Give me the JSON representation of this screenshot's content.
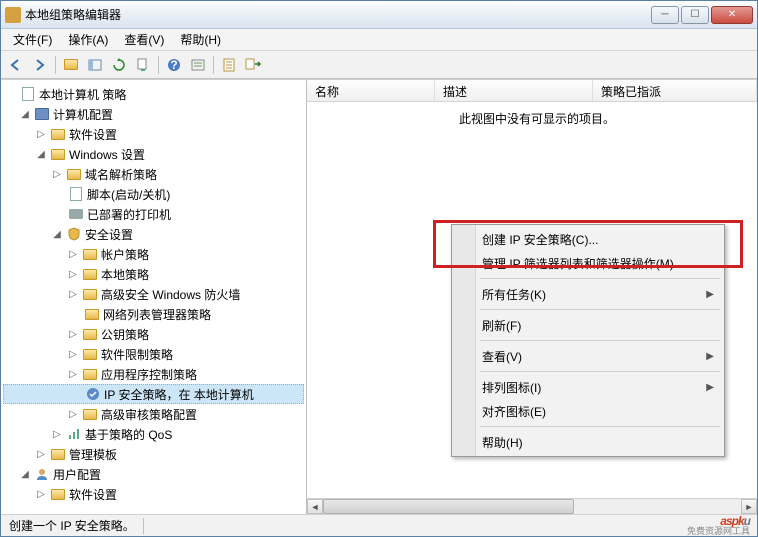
{
  "window": {
    "title": "本地组策略编辑器"
  },
  "menu": {
    "file": "文件(F)",
    "action": "操作(A)",
    "view": "查看(V)",
    "help": "帮助(H)"
  },
  "tree": {
    "root": "本地计算机 策略",
    "computer_config": "计算机配置",
    "software_settings": "软件设置",
    "windows_settings": "Windows 设置",
    "dns_policy": "域名解析策略",
    "scripts": "脚本(启动/关机)",
    "deployed_printers": "已部署的打印机",
    "security_settings": "安全设置",
    "account_policy": "帐户策略",
    "local_policy": "本地策略",
    "adv_firewall": "高级安全 Windows 防火墙",
    "network_list": "网络列表管理器策略",
    "pubkey_policy": "公钥策略",
    "software_restrict": "软件限制策略",
    "app_control": "应用程序控制策略",
    "ip_security": "IP 安全策略，在 本地计算机",
    "adv_audit": "高级审核策略配置",
    "qos": "基于策略的 QoS",
    "admin_templates": "管理模板",
    "user_config": "用户配置",
    "software_settings2": "软件设置"
  },
  "list_cols": {
    "name": "名称",
    "desc": "描述",
    "policy": "策略已指派"
  },
  "list_empty": "此视图中没有可显示的项目。",
  "context": {
    "create_ip": "创建 IP 安全策略(C)...",
    "manage_filter": "管理 IP 筛选器列表和筛选器操作(M)...",
    "all_tasks": "所有任务(K)",
    "refresh": "刷新(F)",
    "view": "查看(V)",
    "arrange_icons": "排列图标(I)",
    "align_icons": "对齐图标(E)",
    "help": "帮助(H)"
  },
  "status": {
    "text": "创建一个 IP 安全策略。"
  },
  "watermark": {
    "main_a": "asp",
    "main_k": "k",
    "main_u": "u",
    "sub": "免费资源网工具"
  }
}
